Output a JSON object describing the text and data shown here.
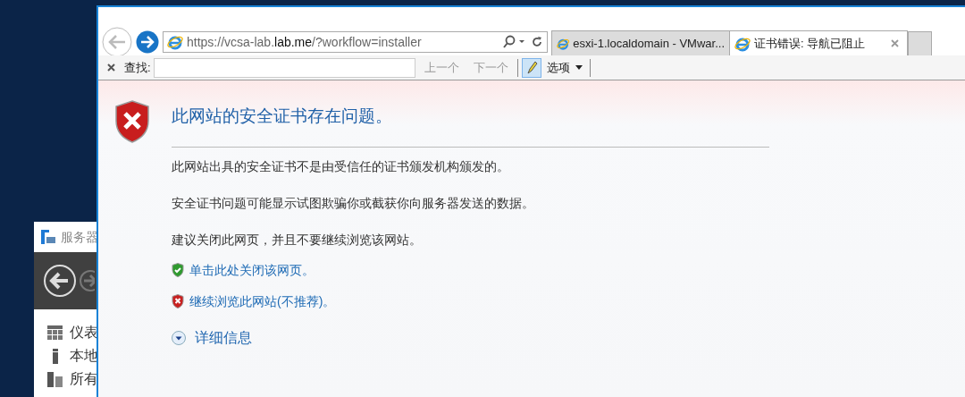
{
  "desktop_window": {
    "title": "服务器",
    "items": [
      {
        "label": "仪表",
        "kind": "grid"
      },
      {
        "label": "本地",
        "kind": "single"
      },
      {
        "label": "所有",
        "kind": "multi"
      }
    ]
  },
  "browser": {
    "address": {
      "before": "https://vcsa-lab.",
      "domain": "lab.me",
      "after": "/?workflow=installer"
    },
    "tabs": [
      {
        "label": "esxi-1.localdomain - VMwar...",
        "selected": false
      },
      {
        "label": "证书错误: 导航已阻止",
        "selected": true
      }
    ],
    "find_bar": {
      "label": "查找:",
      "previous": "上一个",
      "next": "下一个",
      "options": "选项"
    }
  },
  "page": {
    "heading": "此网站的安全证书存在问题。",
    "paragraphs": [
      "此网站出具的安全证书不是由受信任的证书颁发机构颁发的。",
      "安全证书问题可能显示试图欺骗你或截获你向服务器发送的数据。",
      "建议关闭此网页，并且不要继续浏览该网站。"
    ],
    "links": [
      {
        "kind": "safe",
        "text": "单击此处关闭该网页。"
      },
      {
        "kind": "unsafe",
        "text": "继续浏览此网站(不推荐)。"
      }
    ],
    "details": "详细信息"
  }
}
